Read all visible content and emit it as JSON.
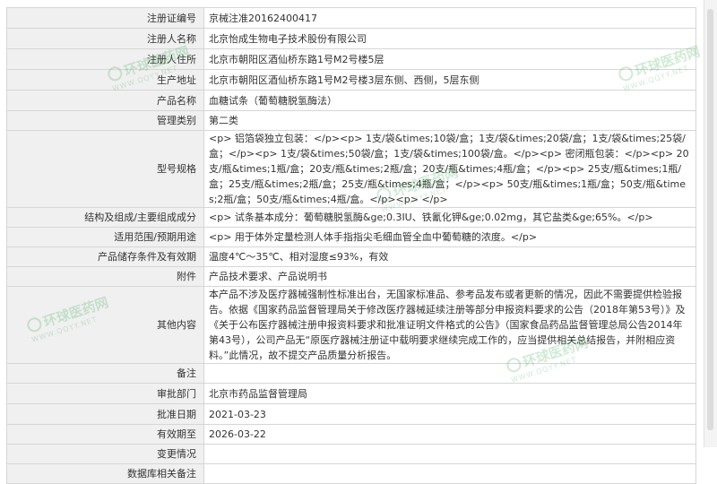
{
  "rows": [
    {
      "label": "注册证编号",
      "value": "京械注准20162400417"
    },
    {
      "label": "注册人名称",
      "value": "北京怡成生物电子技术股份有限公司"
    },
    {
      "label": "注册人住所",
      "value": "北京市朝阳区酒仙桥东路1号M2号楼5层"
    },
    {
      "label": "生产地址",
      "value": "北京市朝阳区酒仙桥东路1号M2号楼3层东侧、西侧，5层东侧"
    },
    {
      "label": "产品名称",
      "value": "血糖试条（葡萄糖脱氢酶法）"
    },
    {
      "label": "管理类别",
      "value": "第二类"
    },
    {
      "label": "型号规格",
      "value": "<p> 铝箔袋独立包装：</p><p> 1支/袋&times;10袋/盒；1支/袋&times;20袋/盒；1支/袋&times;25袋/盒；</p><p> 1支/袋&times;50袋/盒；1支/袋&times;100袋/盒。</p><p> 密闭瓶包装：</p><p> 20支/瓶&times;1瓶/盒；20支/瓶&times;2瓶/盒；20支/瓶&times;4瓶/盒；</p><p> 25支/瓶&times;1瓶/盒；25支/瓶&times;2瓶/盒；25支/瓶&times;4瓶/盒；</p><p> 50支/瓶&times;1瓶/盒；50支/瓶&times;2瓶/盒；50支/瓶&times;4瓶/盒。</p><p> </p>"
    },
    {
      "label": "结构及组成/主要组成成分",
      "value": "<p> 试条基本成分：葡萄糖脱氢酶&ge;0.3IU、铁氰化钾&ge;0.02mg，其它盐类&ge;65%。</p>"
    },
    {
      "label": "适用范围/预期用途",
      "value": "<p> 用于体外定量检测人体手指指尖毛细血管全血中葡萄糖的浓度。</p>"
    },
    {
      "label": "产品储存条件及有效期",
      "value": "温度4℃～35℃、相对湿度≤93%，有效"
    },
    {
      "label": "附件",
      "value": "产品技术要求、产品说明书"
    },
    {
      "label": "其他内容",
      "value": "本产品不涉及医疗器械强制性标准出台，无国家标准品、参考品发布或者更新的情况，因此不需要提供检验报告。依据《国家药品监督管理局关于修改医疗器械延续注册等部分申报资料要求的公告（2018年第53号）》及《关于公布医疗器械注册申报资料要求和批准证明文件格式的公告》（国家食品药品监督管理总局公告2014年第43号），公司产品无“原医疗器械注册证中载明要求继续完成工作的，应当提供相关总结报告，并附相应资料。”此情况，故不提交产品质量分析报告。"
    },
    {
      "label": "备注",
      "value": ""
    },
    {
      "label": "审批部门",
      "value": "北京市药品监督管理局"
    },
    {
      "label": "批准日期",
      "value": "2021-03-23"
    },
    {
      "label": "有效期至",
      "value": "2026-03-22"
    },
    {
      "label": "变更情况",
      "value": ""
    },
    {
      "label": "数据库相关备注",
      "value": ""
    }
  ],
  "watermark": {
    "name": "环球医药网",
    "url": "WWW.QQYY.NET"
  },
  "colors": {
    "label_bg": "#f0f0f0",
    "border": "#d6d6d6",
    "watermark": "#2fa14a"
  }
}
